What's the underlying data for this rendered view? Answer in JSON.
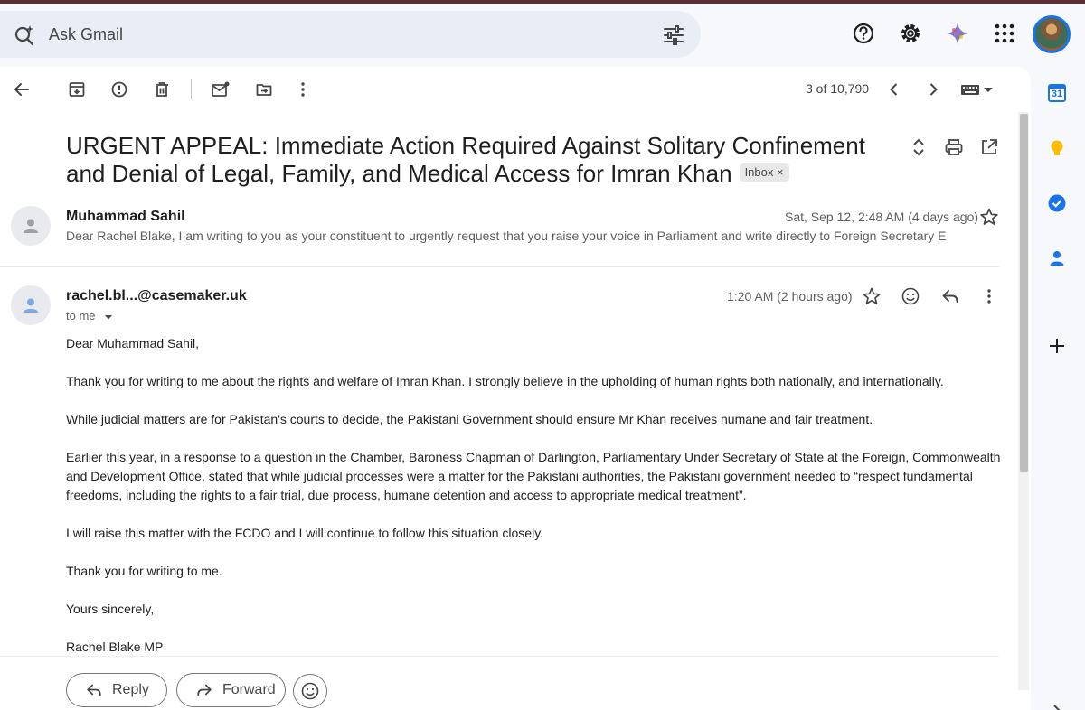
{
  "search": {
    "placeholder": "Ask Gmail"
  },
  "header_icons": [
    "help-icon",
    "settings-icon",
    "gemini-sparkle-icon",
    "apps-grid-icon"
  ],
  "toolbar": {
    "pager": "3 of 10,790"
  },
  "thread": {
    "subject": "URGENT APPEAL: Immediate Action Required Against Solitary Confinement and Denial of Legal, Family, and Medical Access for Imran Khan",
    "label_chip": "Inbox",
    "label_close": "×"
  },
  "messages": [
    {
      "sender": "Muhammad Sahil",
      "date": "Sat, Sep 12, 2:48 AM (4 days ago)",
      "snippet": "Dear Rachel Blake, I am writing to you as your constituent to urgently request that you raise your voice in Parliament and write directly to Foreign Secretary E"
    },
    {
      "sender": "rachel.bl...@casemaker.uk",
      "date": "1:20 AM (2 hours ago)",
      "recipient": "to me",
      "body": [
        "Dear Muhammad Sahil,",
        "Thank you for writing to me about the rights and welfare of Imran Khan. I strongly believe in the upholding of human rights both nationally, and internationally.",
        "While judicial matters are for Pakistan's courts to decide, the Pakistani Government should ensure Mr Khan receives humane and fair treatment.",
        "Earlier this year, in a response to a question in the Chamber, Baroness Chapman of Darlington, Parliamentary Under Secretary of State at the Foreign, Commonwealth and Development Office, stated that while judicial processes were a matter for the Pakistani authorities, the Pakistani government needed to “respect fundamental freedoms, including the rights to a fair trial, due process, humane detention and access to appropriate medical treatment”.",
        "I will raise this matter with the FCDO and I will continue to follow this situation closely.",
        "Thank you for writing to me.",
        "Yours sincerely,",
        "Rachel Blake MP"
      ]
    }
  ],
  "actions": {
    "reply": "Reply",
    "forward": "Forward"
  },
  "side_panel": {
    "calendar_day": "31"
  },
  "colors": {
    "accent": "#1a73e8",
    "search_bg": "#e9eef6",
    "page_bg": "#f6f8fc"
  }
}
